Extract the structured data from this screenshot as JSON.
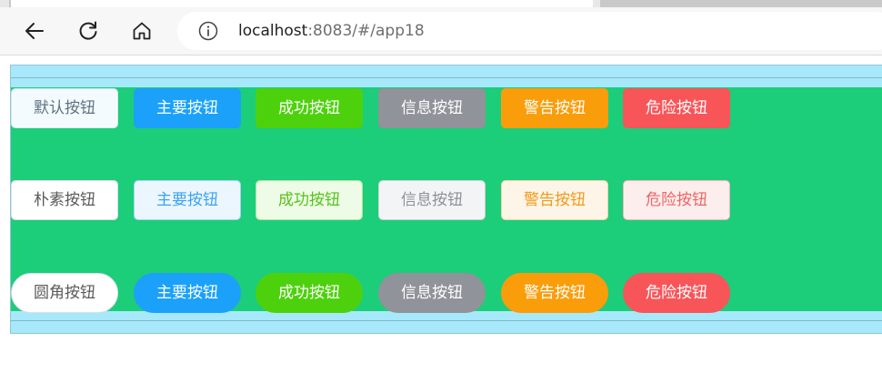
{
  "browser": {
    "url_host": "localhost",
    "url_rest": ":8083/#/app18",
    "icons": [
      "back-arrow-icon",
      "reload-icon",
      "home-icon",
      "info-icon"
    ]
  },
  "rows": [
    {
      "name": "default-row",
      "buttons": [
        {
          "name": "default-button",
          "label": "默认按钮",
          "bg": "#f4fbfe",
          "border": "#d8e6ee",
          "color": "#5f7381"
        },
        {
          "name": "primary-button",
          "label": "主要按钮",
          "bg": "#1ba1fa",
          "border": "#1ba1fa",
          "color": "#ffffff"
        },
        {
          "name": "success-button",
          "label": "成功按钮",
          "bg": "#4ed10d",
          "border": "#4ed10d",
          "color": "#ffffff"
        },
        {
          "name": "info-button",
          "label": "信息按钮",
          "bg": "#909399",
          "border": "#909399",
          "color": "#ffffff"
        },
        {
          "name": "warning-button",
          "label": "警告按钮",
          "bg": "#fa9d0a",
          "border": "#fa9d0a",
          "color": "#ffffff"
        },
        {
          "name": "danger-button",
          "label": "危险按钮",
          "bg": "#f85559",
          "border": "#f85559",
          "color": "#ffffff"
        }
      ]
    },
    {
      "name": "plain-row",
      "buttons": [
        {
          "name": "plain-button",
          "label": "朴素按钮",
          "bg": "#ffffff",
          "border": "#dcdfe6",
          "color": "#5a5a5a"
        },
        {
          "name": "plain-primary-button",
          "label": "主要按钮",
          "bg": "#ecf6ff",
          "border": "#a3d5fb",
          "color": "#3ba3f3"
        },
        {
          "name": "plain-success-button",
          "label": "成功按钮",
          "bg": "#eefbe6",
          "border": "#aee89a",
          "color": "#55c31a"
        },
        {
          "name": "plain-info-button",
          "label": "信息按钮",
          "bg": "#f3f4f5",
          "border": "#cfd1d6",
          "color": "#8e9297"
        },
        {
          "name": "plain-warning-button",
          "label": "警告按钮",
          "bg": "#fdf5e8",
          "border": "#f5d4a0",
          "color": "#f19a1a"
        },
        {
          "name": "plain-danger-button",
          "label": "危险按钮",
          "bg": "#fdeeee",
          "border": "#f4b4b4",
          "color": "#ee6566"
        }
      ]
    },
    {
      "name": "round-row",
      "buttons": [
        {
          "name": "round-button",
          "label": "圆角按钮",
          "bg": "#ffffff",
          "border": "#dcdfe6",
          "color": "#5a5a5a"
        },
        {
          "name": "round-primary-button",
          "label": "主要按钮",
          "bg": "#1ba1fa",
          "border": "#1ba1fa",
          "color": "#ffffff"
        },
        {
          "name": "round-success-button",
          "label": "成功按钮",
          "bg": "#4ed10d",
          "border": "#4ed10d",
          "color": "#ffffff"
        },
        {
          "name": "round-info-button",
          "label": "信息按钮",
          "bg": "#909399",
          "border": "#909399",
          "color": "#ffffff"
        },
        {
          "name": "round-warning-button",
          "label": "警告按钮",
          "bg": "#fa9d0a",
          "border": "#fa9d0a",
          "color": "#ffffff"
        },
        {
          "name": "round-danger-button",
          "label": "危险按钮",
          "bg": "#f85559",
          "border": "#f85559",
          "color": "#ffffff"
        }
      ]
    }
  ],
  "colors": {
    "panel_bg": "#1ccd7a",
    "frame_bg": "#a7e8fb"
  }
}
